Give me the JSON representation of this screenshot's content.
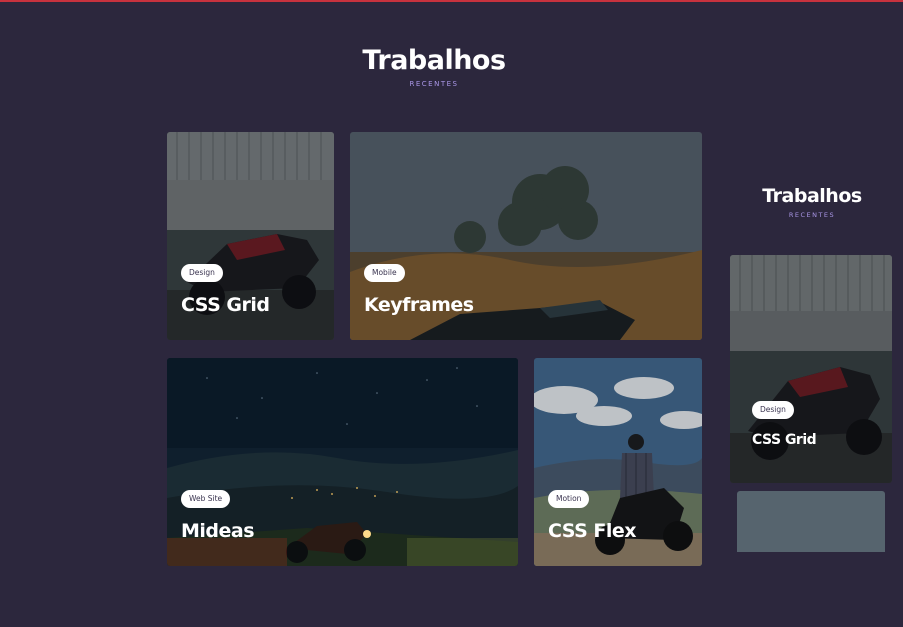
{
  "section": {
    "title": "Trabalhos",
    "subtitle": "RECENTES"
  },
  "side_preview": {
    "title": "Trabalhos",
    "subtitle": "RECENTES",
    "card": {
      "tag": "Design",
      "title": "CSS Grid"
    }
  },
  "cards": [
    {
      "tag": "Design",
      "title": "CSS Grid"
    },
    {
      "tag": "Mobile",
      "title": "Keyframes"
    },
    {
      "tag": "Web Site",
      "title": "Mideas"
    },
    {
      "tag": "Motion",
      "title": "CSS Flex"
    }
  ],
  "colors": {
    "background": "#2c273d",
    "accent_line": "#c8323e",
    "subtitle": "#a996e6",
    "tag_background": "#ffffff"
  }
}
